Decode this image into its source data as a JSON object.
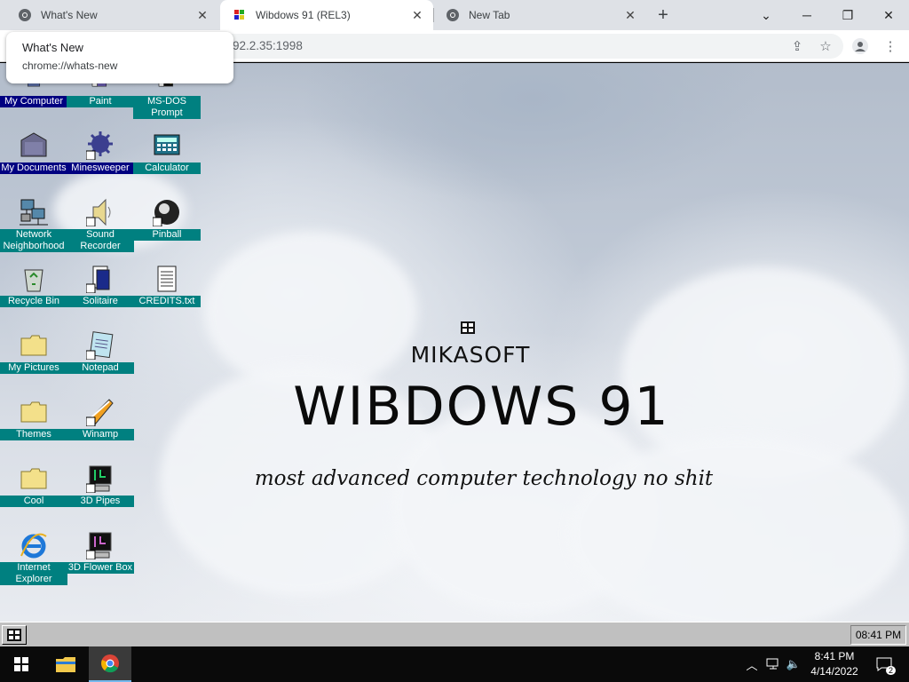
{
  "browser": {
    "tabs": [
      {
        "title": "What's New",
        "favicon": "chrome-icon"
      },
      {
        "title": "Wibdows 91 (REL3)",
        "favicon": "windows-flag-icon",
        "active": true
      },
      {
        "title": "New Tab",
        "favicon": "chrome-icon"
      }
    ],
    "new_tab_label": "+",
    "address_partial": "92.2.35:1998",
    "tooltip": {
      "title": "What's New",
      "url": "chrome://whats-new"
    }
  },
  "desktop": {
    "icons": [
      {
        "label": "My Computer",
        "icon": "my-computer-icon"
      },
      {
        "label": "Paint",
        "icon": "paint-icon"
      },
      {
        "label": "MS-DOS Prompt",
        "icon": "msdos-icon"
      },
      {
        "label": "My Documents",
        "icon": "folder-documents-icon"
      },
      {
        "label": "Minesweeper",
        "icon": "mine-icon"
      },
      {
        "label": "Calculator",
        "icon": "calculator-icon"
      },
      {
        "label": "Network Neighborhood",
        "icon": "network-icon"
      },
      {
        "label": "Sound Recorder",
        "icon": "speaker-icon"
      },
      {
        "label": "Pinball",
        "icon": "pinball-icon"
      },
      {
        "label": "Recycle Bin",
        "icon": "recycle-bin-icon"
      },
      {
        "label": "Solitaire",
        "icon": "cards-icon"
      },
      {
        "label": "CREDITS.txt",
        "icon": "text-file-icon"
      },
      {
        "label": "My Pictures",
        "icon": "folder-icon"
      },
      {
        "label": "Notepad",
        "icon": "notepad-icon"
      },
      {
        "label": "Themes",
        "icon": "folder-icon"
      },
      {
        "label": "Winamp",
        "icon": "winamp-icon"
      },
      {
        "label": "Cool",
        "icon": "folder-icon"
      },
      {
        "label": "3D Pipes",
        "icon": "screensaver-icon"
      },
      {
        "label": "Internet Explorer",
        "icon": "internet-explorer-icon"
      },
      {
        "label": "3D Flower Box",
        "icon": "screensaver-icon"
      }
    ],
    "splash": {
      "brand": "MIKASOFT",
      "product": "WIBDOWS 91",
      "tagline": "most advanced computer technology no shit"
    }
  },
  "w98_taskbar": {
    "clock": "08:41 PM"
  },
  "win10_taskbar": {
    "time": "8:41 PM",
    "date": "4/14/2022",
    "notification_count": "2"
  }
}
